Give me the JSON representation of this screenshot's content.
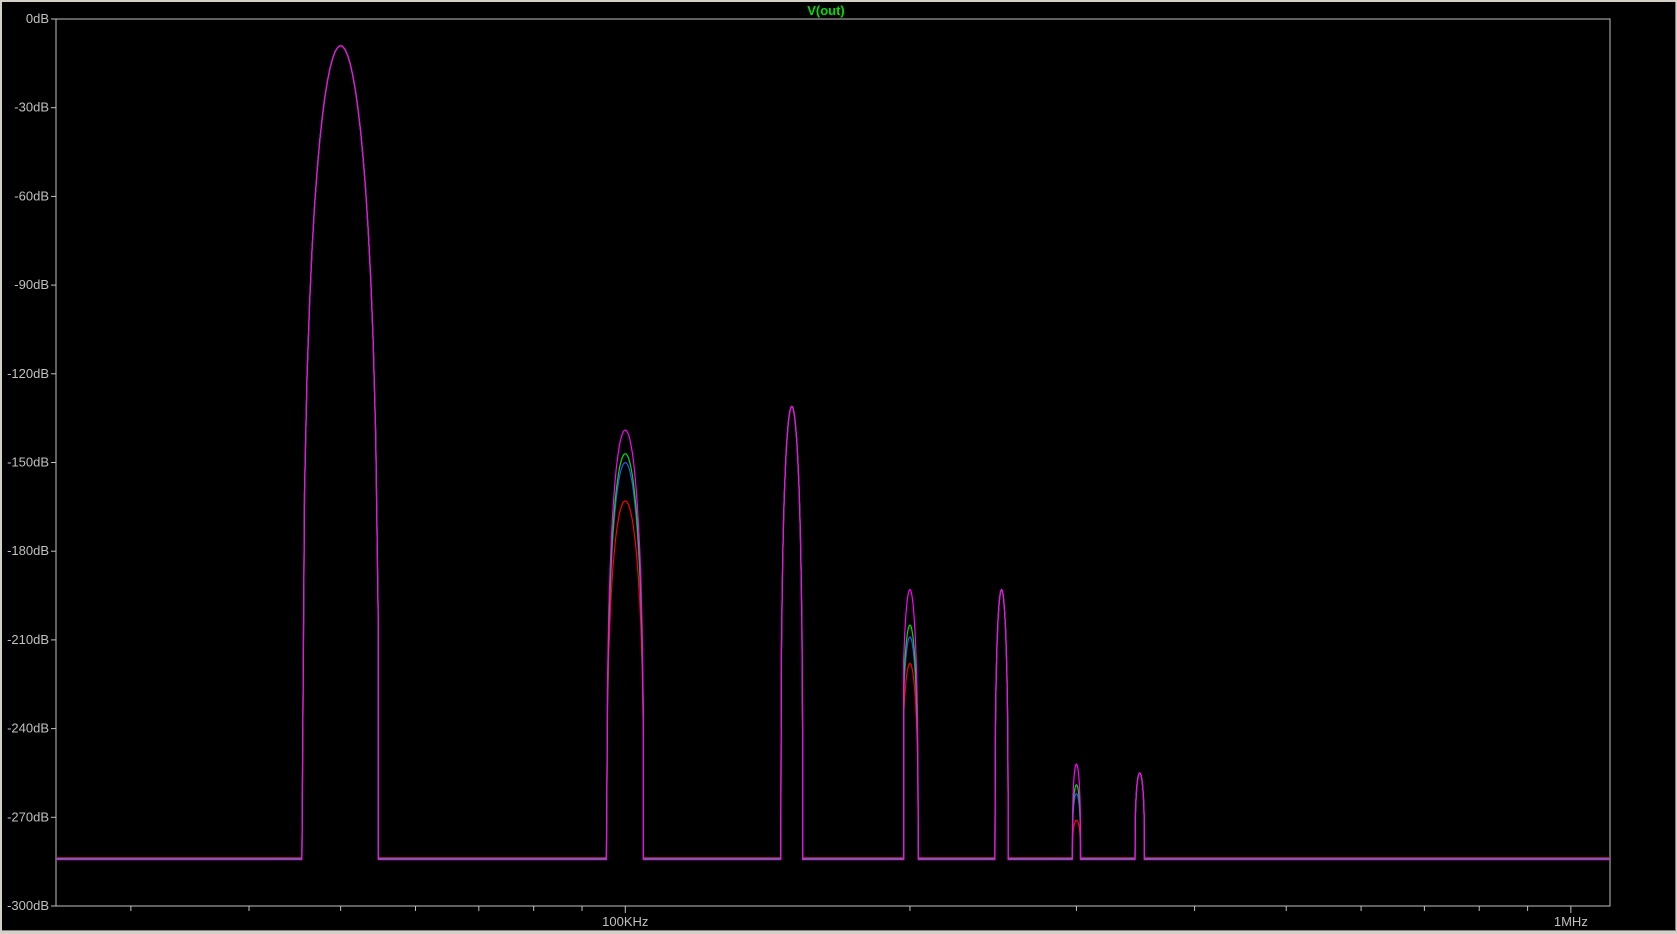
{
  "chart_data": {
    "type": "line",
    "title": "V(out)",
    "title_color": "#00e000",
    "xscale": "log",
    "xlim": [
      25000,
      1100000
    ],
    "ylim": [
      -300,
      0
    ],
    "y_ticks": [
      0,
      -30,
      -60,
      -90,
      -120,
      -150,
      -180,
      -210,
      -240,
      -270,
      -300
    ],
    "y_tick_labels": [
      "0dB",
      "-30dB",
      "-60dB",
      "-90dB",
      "-120dB",
      "-150dB",
      "-180dB",
      "-210dB",
      "-240dB",
      "-270dB",
      "-300dB"
    ],
    "x_major_ticks": [
      100000,
      1000000
    ],
    "x_tick_labels": [
      "100KHz",
      "1MHz"
    ],
    "x_minor_ticks": [
      30000,
      40000,
      50000,
      60000,
      70000,
      80000,
      90000,
      200000,
      300000,
      400000,
      500000,
      600000,
      700000,
      800000,
      900000
    ],
    "grid": false,
    "background": "#000000",
    "axis_color": "#c0c0c0",
    "noise_floor": -284,
    "peaks": [
      {
        "f": 50000,
        "fl": 45500,
        "fh": 54800,
        "levels": [
          -9,
          -9,
          -9,
          -9
        ]
      },
      {
        "f": 100000,
        "fl": 95500,
        "fh": 104500,
        "levels": [
          -163,
          -150,
          -147,
          -139
        ]
      },
      {
        "f": 150000,
        "fl": 146000,
        "fh": 154000,
        "levels": [
          -131,
          -131,
          -131,
          -131
        ]
      },
      {
        "f": 200000,
        "fl": 197000,
        "fh": 205000,
        "levels": [
          -218,
          -209,
          -205,
          -193
        ]
      },
      {
        "f": 250000,
        "fl": 246000,
        "fh": 254000,
        "levels": [
          -193,
          -193,
          -193,
          -193
        ]
      },
      {
        "f": 300000,
        "fl": 297000,
        "fh": 303000,
        "levels": [
          -271,
          -262,
          -259,
          -252
        ]
      },
      {
        "f": 350000,
        "fl": 346000,
        "fh": 354000,
        "levels": [
          -255,
          -255,
          -255,
          -255
        ]
      }
    ],
    "series": [
      {
        "color": "#ff0000"
      },
      {
        "color": "#3050ff"
      },
      {
        "color": "#00e000"
      },
      {
        "color": "#ff00ff"
      }
    ]
  }
}
